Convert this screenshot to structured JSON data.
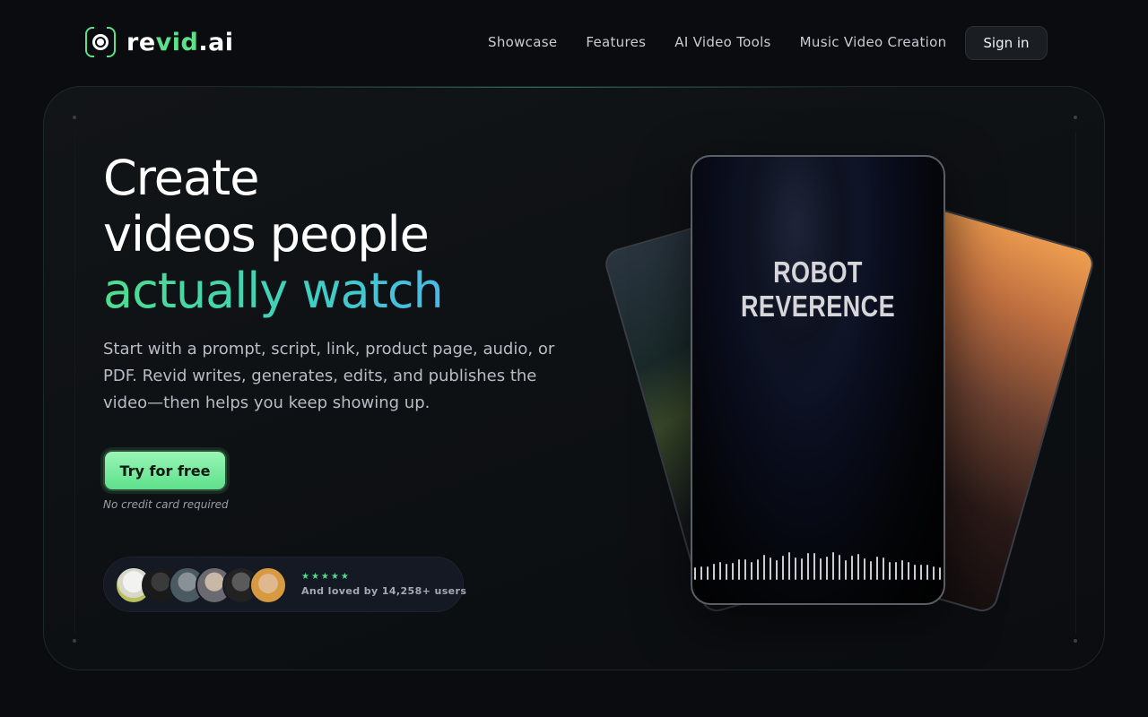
{
  "brand": {
    "name_part1": "re",
    "name_part2": "vid",
    "name_part3": ".ai",
    "accent": "#5ce08a"
  },
  "nav": {
    "items": [
      {
        "label": "Showcase"
      },
      {
        "label": "Features"
      },
      {
        "label": "AI Video Tools"
      },
      {
        "label": "Music Video Creation"
      }
    ]
  },
  "header": {
    "sign_in_label": "Sign in"
  },
  "hero": {
    "headline_line1": "Create",
    "headline_line2": "videos people",
    "headline_line3": "actually watch",
    "subtext": "Start with a prompt, script, link, product page, audio, or PDF. Revid writes, generates, edits, and publishes the video—then helps you keep showing up.",
    "cta_label": "Try for free",
    "cta_note": "No credit card required",
    "stars": "★★★★★",
    "social_proof": "And loved by 14,258+ users"
  },
  "preview": {
    "title": "ROBOT REVERENCE",
    "icons": [
      "avatar",
      "avatar",
      "avatar",
      "avatar",
      "avatar",
      "avatar"
    ]
  }
}
